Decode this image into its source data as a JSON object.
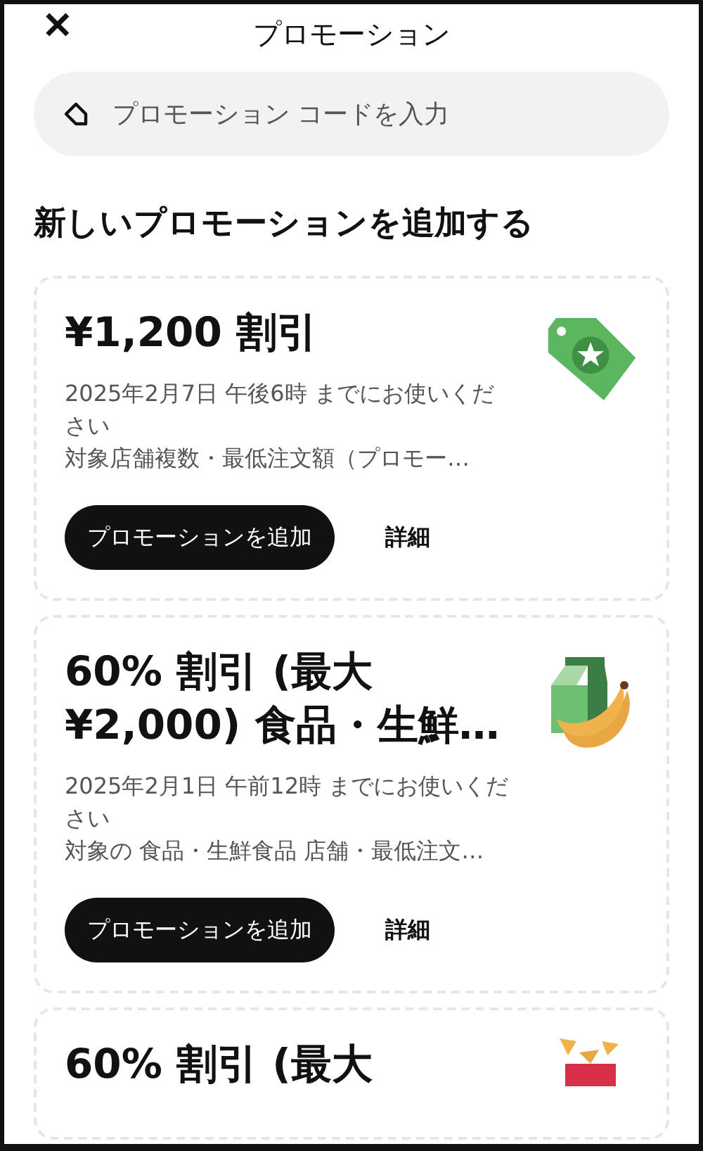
{
  "header": {
    "close": "✕",
    "title": "プロモーション"
  },
  "search": {
    "placeholder": "プロモーション コードを入力"
  },
  "section_title": "新しいプロモーションを追加する",
  "promotions": [
    {
      "kind": "tag",
      "title": "¥1,200 割引",
      "expiry": "2025年2月7日 午後6時 までにお使いください",
      "conditions": "対象店舗複数・最低注文額（プロモー…",
      "add_button": "プロモーションを追加",
      "details_link": "詳細"
    },
    {
      "kind": "grocery",
      "title": "60% 割引 (最大 ¥2,000) 食品・生鮮…",
      "expiry": "2025年2月1日 午前12時 までにお使いください",
      "conditions": "対象の 食品・生鮮食品 店舗・最低注文…",
      "add_button": "プロモーションを追加",
      "details_link": "詳細"
    },
    {
      "kind": "snack",
      "title": "60% 割引 (最大"
    }
  ]
}
